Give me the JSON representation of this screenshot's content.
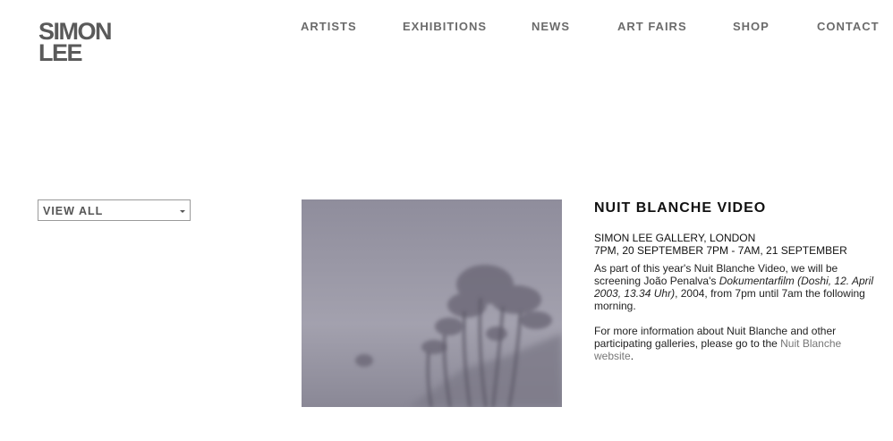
{
  "logo": {
    "line1": "SIMON",
    "line2": "LEE"
  },
  "nav": [
    {
      "label": "ARTISTS"
    },
    {
      "label": "EXHIBITIONS"
    },
    {
      "label": "NEWS"
    },
    {
      "label": "ART FAIRS"
    },
    {
      "label": "SHOP"
    },
    {
      "label": "CONTACT"
    }
  ],
  "filter": {
    "selected": "VIEW ALL"
  },
  "article": {
    "title": "NUIT BLANCHE VIDEO",
    "venue": "SIMON LEE GALLERY, LONDON",
    "time": "7PM, 20 SEPTEMBER 7PM - 7AM, 21 SEPTEMBER",
    "p1_a": "As part of this year's Nuit Blanche Video, we will be screening João Penalva's ",
    "p1_b": "Dokumentarfilm (Doshi, 12. April 2003, 13.34 Uhr)",
    "p1_c": ", 2004, from 7pm until 7am the following morning.",
    "p2_a": "For more information about Nuit Blanche and other participating galleries, please go to the ",
    "p2_link": "Nuit Blanche website",
    "p2_c": "."
  },
  "colors": {
    "nav_text": "#6b6b6b",
    "logo": "#5a5a5a",
    "link": "#777777",
    "photo_fog": "#9c9aa8"
  },
  "icons": {
    "filter_caret": "chevron-down-icon"
  }
}
